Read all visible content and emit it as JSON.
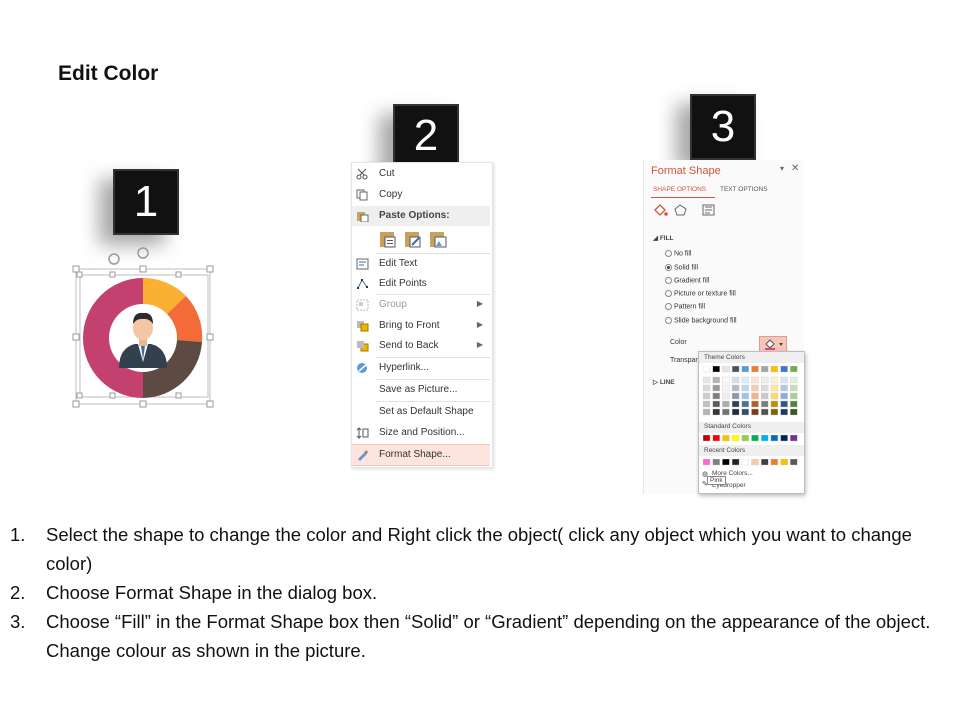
{
  "page": {
    "title": "Edit Color"
  },
  "steps": [
    "1",
    "2",
    "3"
  ],
  "context_menu": {
    "items": [
      {
        "label": "Cut",
        "icon": "scissors-icon"
      },
      {
        "label": "Copy",
        "icon": "copy-icon"
      },
      {
        "label": "Paste Options:",
        "icon": "paste-icon"
      },
      {
        "label": "Edit Text",
        "icon": "edit-text-icon"
      },
      {
        "label": "Edit Points",
        "icon": "edit-points-icon"
      },
      {
        "label": "Group",
        "icon": "group-icon"
      },
      {
        "label": "Bring to Front",
        "icon": "bring-front-icon"
      },
      {
        "label": "Send to Back",
        "icon": "send-back-icon"
      },
      {
        "label": "Hyperlink...",
        "icon": "hyperlink-icon"
      },
      {
        "label": "Save as Picture...",
        "icon": ""
      },
      {
        "label": "Set as Default Shape",
        "icon": ""
      },
      {
        "label": "Size and Position...",
        "icon": "size-position-icon"
      },
      {
        "label": "Format Shape...",
        "icon": "format-shape-icon"
      }
    ]
  },
  "format_pane": {
    "title": "Format Shape",
    "tabs": [
      "SHAPE OPTIONS",
      "TEXT OPTIONS"
    ],
    "fill_section": "FILL",
    "fill_options": [
      "No fill",
      "Solid fill",
      "Gradient fill",
      "Picture or texture fill",
      "Pattern fill",
      "Slide background fill"
    ],
    "color_label": "Color",
    "transparency_label": "Transpare",
    "line_section": "LINE"
  },
  "color_palette": {
    "theme_label": "Theme Colors",
    "standard_label": "Standard Colors",
    "recent_label": "Recent Colors",
    "more_colors": "More Colors...",
    "eyedropper": "Eyedropper",
    "tooltip": "Pink",
    "theme_top": [
      "#ffffff",
      "#000000",
      "#e7e6e6",
      "#44546a",
      "#5b9bd5",
      "#ed7d31",
      "#a5a5a5",
      "#ffc000",
      "#4472c4",
      "#70ad47"
    ],
    "standard": [
      "#c00000",
      "#ff0000",
      "#ffc000",
      "#ffff00",
      "#92d050",
      "#00b050",
      "#00b0f0",
      "#0070c0",
      "#002060",
      "#7030a0"
    ],
    "recent": [
      "#ff66cc",
      "#7f7f7f",
      "#000000",
      "#262626",
      "#ffffff",
      "#f8cbad",
      "#404040",
      "#ed7d31",
      "#ffc000",
      "#595959"
    ]
  },
  "instructions": [
    {
      "num": "1.",
      "text": "Select the shape to change the color and Right click the object( click any object which you want to change color)"
    },
    {
      "num": "2.",
      "text": "Choose Format Shape in the dialog box."
    },
    {
      "num": "3.",
      "text": "Choose “Fill” in the Format Shape box then “Solid” or “Gradient” depending on the appearance of the object. Change colour as shown in the picture."
    }
  ]
}
